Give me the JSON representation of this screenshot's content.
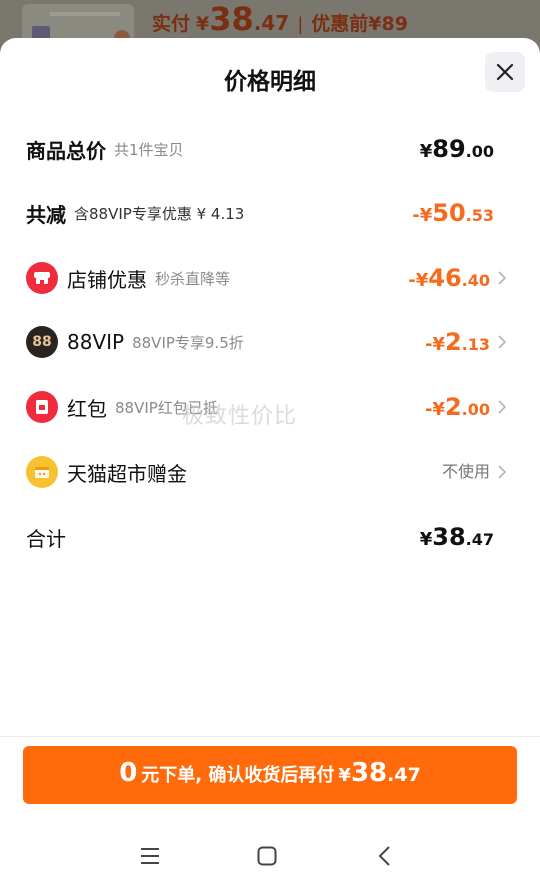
{
  "backdrop": {
    "price_label": "实付",
    "yen": "¥",
    "price_int": "38",
    "price_dec": ".47",
    "separator": "|",
    "original_label": "优惠前¥89"
  },
  "sheet": {
    "title": "价格明细"
  },
  "rows": {
    "total": {
      "label": "商品总价",
      "sub": "共1件宝贝",
      "yen": "¥",
      "int": "89",
      "dec": ".00"
    },
    "reduced": {
      "label": "共减",
      "sub": "含88VIP专享优惠 ¥ 4.13",
      "prefix": "-¥",
      "int": "50",
      "dec": ".53"
    },
    "shop": {
      "icon": "shop-icon",
      "label": "店铺优惠",
      "sub": "秒杀直降等",
      "prefix": "-¥",
      "int": "46",
      "dec": ".40"
    },
    "vip": {
      "icon": "vip-badge-icon",
      "icon_text": "88",
      "label": "88VIP",
      "sub": "88VIP专享9.5折",
      "prefix": "-¥",
      "int": "2",
      "dec": ".13"
    },
    "redpacket": {
      "icon": "red-packet-icon",
      "label": "红包",
      "sub": "88VIP红包已抵",
      "prefix": "-¥",
      "int": "2",
      "dec": ".00"
    },
    "tmall": {
      "icon": "tmall-cat-icon",
      "label": "天猫超市赠金",
      "status": "不使用"
    },
    "sum": {
      "label": "合计",
      "yen": "¥",
      "int": "38",
      "dec": ".47"
    }
  },
  "watermark": "极致性价比",
  "cta": {
    "zero": "0",
    "text": "元下单, 确认收货后再付",
    "yen": "¥",
    "int": "38",
    "dec": ".47"
  },
  "colors": {
    "accent": "#ff6a0b",
    "discount": "#f56a1d",
    "shop_red": "#ef2b3d",
    "vip_dark": "#2a2420",
    "cat_yellow": "#f6c22f"
  },
  "navbar": {
    "menu": "menu-icon",
    "home": "home-icon",
    "back": "back-icon"
  }
}
